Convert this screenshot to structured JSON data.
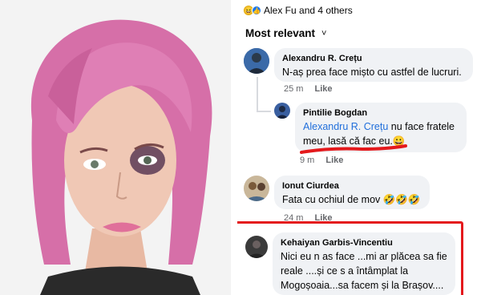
{
  "reactions": {
    "icons": [
      "haha-icon",
      "like-icon"
    ],
    "text": "Alex Fu and 4 others"
  },
  "sort": {
    "label": "Most relevant",
    "chevron": "˅"
  },
  "comments": [
    {
      "author": "Alexandru R. Crețu",
      "text": "N-aș prea face mișto cu astfel de lucruri.",
      "time": "25 m",
      "action": "Like"
    },
    {
      "author": "Pintilie Bogdan",
      "mention": "Alexandru R. Crețu",
      "text_line1": " nu face fratele",
      "text_line2": "meu, lasă că fac eu.",
      "emoji": "😀",
      "time": "9 m",
      "action": "Like"
    },
    {
      "author": "Ionut Ciurdea",
      "text": "Fata cu ochiul de mov 🤣🤣🤣",
      "time": "24 m",
      "action": "Like"
    },
    {
      "author": "Kehaiyan Garbis-Vincentiu",
      "text_line1": "Nici eu n as face ...mi ar plăcea sa fie",
      "text_line2": "reale ....și ce s a întâmplat la",
      "text_line3": "Mogoșoaia...sa facem și la Brașov...."
    }
  ],
  "colors": {
    "accent_link": "#216fdb",
    "highlight": "#e4191c",
    "bubble": "#f0f2f5"
  }
}
